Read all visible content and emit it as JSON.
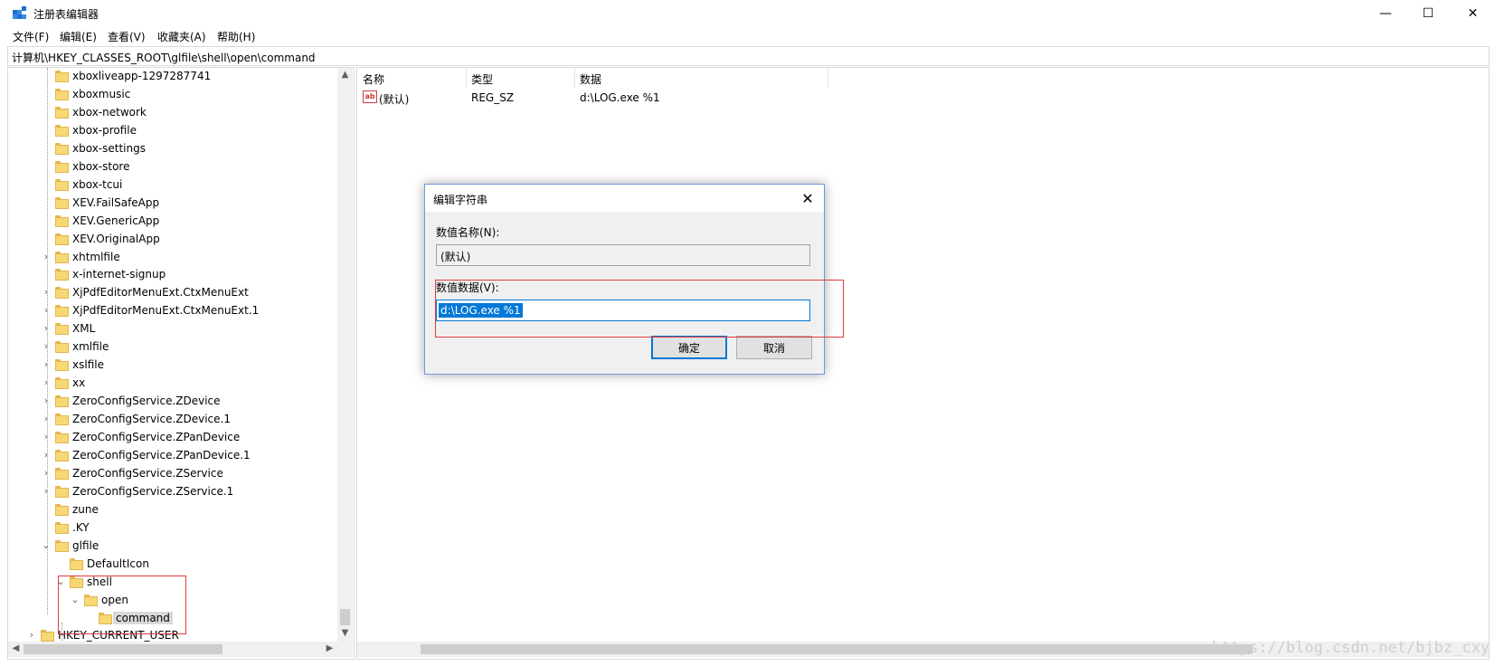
{
  "window": {
    "title": "注册表编辑器",
    "min_glyph": "—",
    "max_glyph": "☐",
    "close_glyph": "✕"
  },
  "menu": [
    "文件(F)",
    "编辑(E)",
    "查看(V)",
    "收藏夹(A)",
    "帮助(H)"
  ],
  "address": "计算机\\HKEY_CLASSES_ROOT\\glfile\\shell\\open\\command",
  "tree": {
    "items": [
      {
        "label": "xboxliveapp-1297287741",
        "expander": ""
      },
      {
        "label": "xboxmusic",
        "expander": ""
      },
      {
        "label": "xbox-network",
        "expander": ""
      },
      {
        "label": "xbox-profile",
        "expander": ""
      },
      {
        "label": "xbox-settings",
        "expander": ""
      },
      {
        "label": "xbox-store",
        "expander": ""
      },
      {
        "label": "xbox-tcui",
        "expander": ""
      },
      {
        "label": "XEV.FailSafeApp",
        "expander": ""
      },
      {
        "label": "XEV.GenericApp",
        "expander": ""
      },
      {
        "label": "XEV.OriginalApp",
        "expander": ""
      },
      {
        "label": "xhtmlfile",
        "expander": "›"
      },
      {
        "label": "x-internet-signup",
        "expander": ""
      },
      {
        "label": "XjPdfEditorMenuExt.CtxMenuExt",
        "expander": "›"
      },
      {
        "label": "XjPdfEditorMenuExt.CtxMenuExt.1",
        "expander": "›"
      },
      {
        "label": "XML",
        "expander": "›"
      },
      {
        "label": "xmlfile",
        "expander": "›"
      },
      {
        "label": "xslfile",
        "expander": "›"
      },
      {
        "label": "xx",
        "expander": "›"
      },
      {
        "label": "ZeroConfigService.ZDevice",
        "expander": "›"
      },
      {
        "label": "ZeroConfigService.ZDevice.1",
        "expander": "›"
      },
      {
        "label": "ZeroConfigService.ZPanDevice",
        "expander": "›"
      },
      {
        "label": "ZeroConfigService.ZPanDevice.1",
        "expander": "›"
      },
      {
        "label": "ZeroConfigService.ZService",
        "expander": "›"
      },
      {
        "label": "ZeroConfigService.ZService.1",
        "expander": "›"
      },
      {
        "label": "zune",
        "expander": ""
      },
      {
        "label": ".KY",
        "expander": ""
      },
      {
        "label": "glfile",
        "expander": "⌄"
      },
      {
        "label": "DefaultIcon",
        "expander": ""
      },
      {
        "label": "shell",
        "expander": "⌄"
      },
      {
        "label": "open",
        "expander": "⌄"
      },
      {
        "label": "command",
        "expander": ""
      },
      {
        "label": "HKEY_CURRENT_USER",
        "expander": "›"
      }
    ]
  },
  "values": {
    "headers": [
      "名称",
      "类型",
      "数据"
    ],
    "rows": [
      {
        "icon": "ab",
        "name": "(默认)",
        "type": "REG_SZ",
        "data": "d:\\LOG.exe %1"
      }
    ]
  },
  "dialog": {
    "title": "编辑字符串",
    "close_glyph": "✕",
    "name_label": "数值名称(N):",
    "name_value": "(默认)",
    "data_label": "数值数据(V):",
    "data_value": "d:\\LOG.exe %1",
    "ok_label": "确定",
    "cancel_label": "取消"
  },
  "scroll_arrows": {
    "up": "▲",
    "down": "▼",
    "left": "◀",
    "right": "▶"
  },
  "watermark": "https://blog.csdn.net/bjbz_cxy",
  "colors": {
    "accent": "#0078d7",
    "annotation_red": "#e23b3b",
    "folder_yellow": "#f8d775"
  }
}
